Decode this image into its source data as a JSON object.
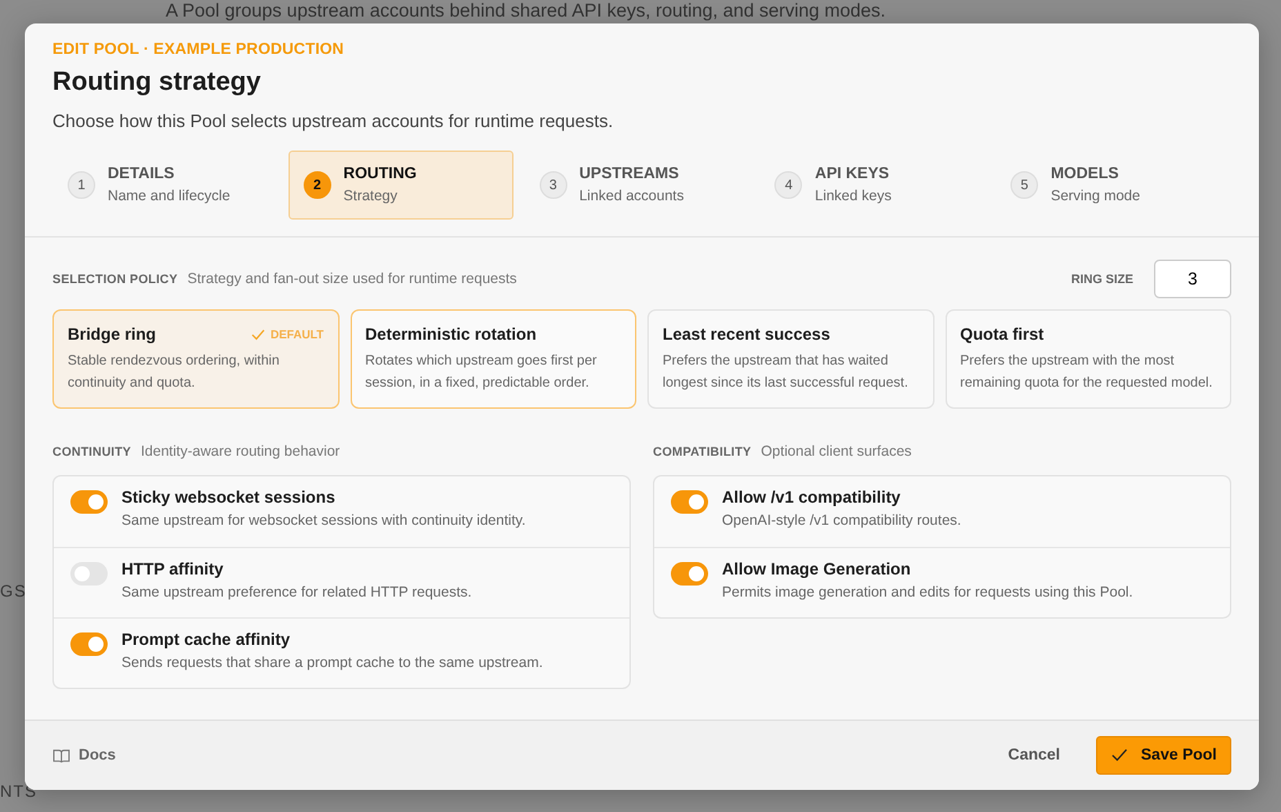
{
  "background": {
    "description": "A Pool groups upstream accounts behind shared API keys, routing, and serving modes.",
    "fragments": [
      {
        "text": "GS",
        "kind": "nav"
      },
      {
        "text": "NTS",
        "kind": "nav"
      }
    ]
  },
  "dialog": {
    "eyebrow": "EDIT POOL · EXAMPLE PRODUCTION",
    "title": "Routing strategy",
    "subtitle": "Choose how this Pool selects upstream accounts for runtime requests.",
    "steps": [
      {
        "number": "1",
        "label": "DETAILS",
        "sublabel": "Name and lifecycle",
        "selected": false
      },
      {
        "number": "2",
        "label": "ROUTING",
        "sublabel": "Strategy",
        "selected": true
      },
      {
        "number": "3",
        "label": "UPSTREAMS",
        "sublabel": "Linked accounts",
        "selected": false
      },
      {
        "number": "4",
        "label": "API KEYS",
        "sublabel": "Linked keys",
        "selected": false
      },
      {
        "number": "5",
        "label": "MODELS",
        "sublabel": "Serving mode",
        "selected": false
      }
    ],
    "selection_policy": {
      "heading": "SELECTION POLICY",
      "hint": "Strategy and fan-out size used for runtime requests",
      "ring_size_label": "RING SIZE",
      "ring_size": "3",
      "options": [
        {
          "title": "Bridge ring",
          "description": "Stable rendezvous ordering, within continuity and quota.",
          "badge": "DEFAULT",
          "selected": true,
          "focused": false
        },
        {
          "title": "Deterministic rotation",
          "description": "Rotates which upstream goes first per session, in a fixed, predictable order.",
          "selected": false,
          "focused": true
        },
        {
          "title": "Least recent success",
          "description": "Prefers the upstream that has waited longest since its last successful request.",
          "selected": false,
          "focused": false
        },
        {
          "title": "Quota first",
          "description": "Prefers the upstream with the most remaining quota for the requested model.",
          "selected": false,
          "focused": false
        }
      ]
    },
    "continuity": {
      "heading": "CONTINUITY",
      "hint": "Identity-aware routing behavior",
      "settings": [
        {
          "title": "Sticky websocket sessions",
          "description": "Same upstream for websocket sessions with continuity identity.",
          "on": true
        },
        {
          "title": "HTTP affinity",
          "description": "Same upstream preference for related HTTP requests.",
          "on": false
        },
        {
          "title": "Prompt cache affinity",
          "description": "Sends requests that share a prompt cache to the same upstream.",
          "on": true
        }
      ]
    },
    "compatibility": {
      "heading": "COMPATIBILITY",
      "hint": "Optional client surfaces",
      "settings": [
        {
          "title": "Allow /v1 compatibility",
          "description": "OpenAI-style /v1 compatibility routes.",
          "on": true
        },
        {
          "title": "Allow Image Generation",
          "description": "Permits image generation and edits for requests using this Pool.",
          "on": true
        }
      ]
    },
    "footer": {
      "docs": "Docs",
      "cancel": "Cancel",
      "save": "Save Pool"
    }
  }
}
